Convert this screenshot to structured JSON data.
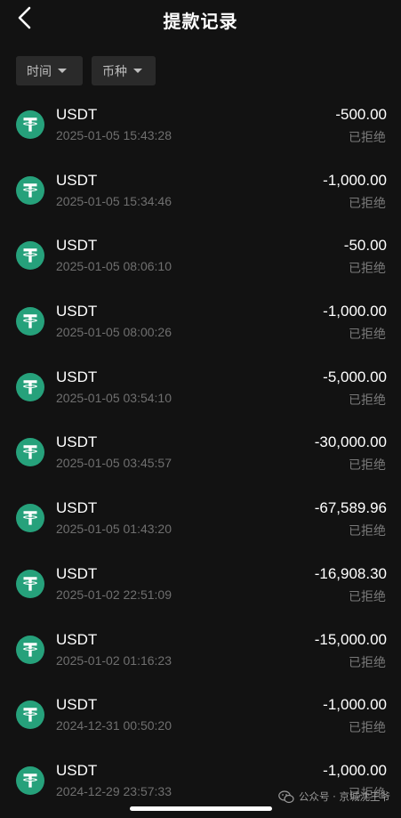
{
  "header": {
    "title": "提款记录",
    "back_icon": "chevron-left-icon"
  },
  "filters": {
    "time_label": "时间",
    "coin_label": "币种"
  },
  "colors": {
    "background": "#121212",
    "coin_icon": "#26a17b",
    "filter_bg": "#2a2a2a",
    "secondary_text": "#6f6f6f"
  },
  "records": [
    {
      "coin": "USDT",
      "datetime": "2025-01-05 15:43:28",
      "amount": "-500.00",
      "status": "已拒绝"
    },
    {
      "coin": "USDT",
      "datetime": "2025-01-05 15:34:46",
      "amount": "-1,000.00",
      "status": "已拒绝"
    },
    {
      "coin": "USDT",
      "datetime": "2025-01-05 08:06:10",
      "amount": "-50.00",
      "status": "已拒绝"
    },
    {
      "coin": "USDT",
      "datetime": "2025-01-05 08:00:26",
      "amount": "-1,000.00",
      "status": "已拒绝"
    },
    {
      "coin": "USDT",
      "datetime": "2025-01-05 03:54:10",
      "amount": "-5,000.00",
      "status": "已拒绝"
    },
    {
      "coin": "USDT",
      "datetime": "2025-01-05 03:45:57",
      "amount": "-30,000.00",
      "status": "已拒绝"
    },
    {
      "coin": "USDT",
      "datetime": "2025-01-05 01:43:20",
      "amount": "-67,589.96",
      "status": "已拒绝"
    },
    {
      "coin": "USDT",
      "datetime": "2025-01-02 22:51:09",
      "amount": "-16,908.30",
      "status": "已拒绝"
    },
    {
      "coin": "USDT",
      "datetime": "2025-01-02 01:16:23",
      "amount": "-15,000.00",
      "status": "已拒绝"
    },
    {
      "coin": "USDT",
      "datetime": "2024-12-31 00:50:20",
      "amount": "-1,000.00",
      "status": "已拒绝"
    },
    {
      "coin": "USDT",
      "datetime": "2024-12-29 23:57:33",
      "amount": "-1,000.00",
      "status": "已拒绝"
    }
  ],
  "watermark": {
    "text": "公众号 · 京城沈王爷",
    "icon": "wechat-icon"
  }
}
